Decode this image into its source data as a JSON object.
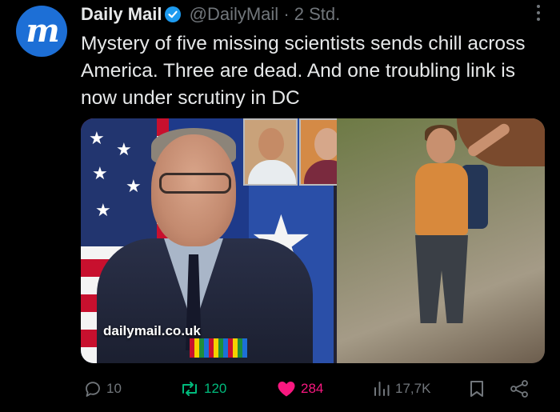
{
  "author": {
    "avatar_letter": "m",
    "name": "Daily Mail",
    "handle": "@DailyMail",
    "separator": "·",
    "time": "2 Std."
  },
  "post": {
    "text": "Mystery of five missing scientists sends chill across America. Three are dead. And one troubling link is now under scrutiny in DC",
    "watermark": "dailymail.co.uk"
  },
  "actions": {
    "replies": "10",
    "reposts": "120",
    "likes": "284",
    "views": "17,7K"
  },
  "colors": {
    "background": "#000000",
    "text": "#e7e9ea",
    "muted": "#71767b",
    "verified": "#1d9bf0",
    "repost": "#00ba7c",
    "like": "#f91880",
    "avatar": "#1d6fd6"
  },
  "icons": [
    "verified-badge-icon",
    "more-options-icon",
    "reply-icon",
    "repost-icon",
    "like-heart-icon",
    "views-chart-icon",
    "bookmark-icon",
    "share-icon"
  ]
}
